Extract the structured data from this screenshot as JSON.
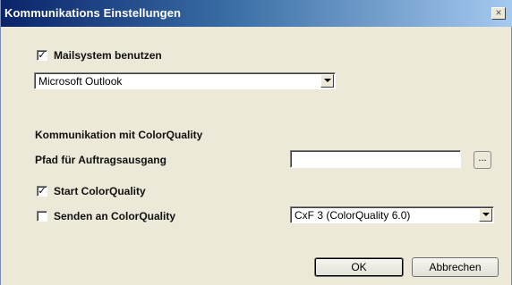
{
  "window": {
    "title": "Kommunikations Einstellungen",
    "close_glyph": "×"
  },
  "mail": {
    "checkbox_checked": true,
    "checkbox_label": "Mailsystem benutzen",
    "client_selected": "Microsoft Outlook"
  },
  "colorquality": {
    "section_title": "Kommunikation mit ColorQuality",
    "output_path_label": "Pfad für Auftragsausgang",
    "output_path_value": "",
    "browse_label": "...",
    "start_checked": true,
    "start_label": "Start ColorQuality",
    "send_checked": false,
    "send_label": "Senden an ColorQuality",
    "format_selected": "CxF 3 (ColorQuality 6.0)"
  },
  "buttons": {
    "ok": "OK",
    "cancel": "Abbrechen"
  },
  "colors": {
    "dialog_bg": "#ece9d8",
    "titlebar_start": "#0a246a",
    "titlebar_end": "#a6caf0",
    "title_text": "#ffffff"
  },
  "icons": {
    "close": "close-icon",
    "dropdown": "chevron-down-icon",
    "check": "check-icon"
  }
}
